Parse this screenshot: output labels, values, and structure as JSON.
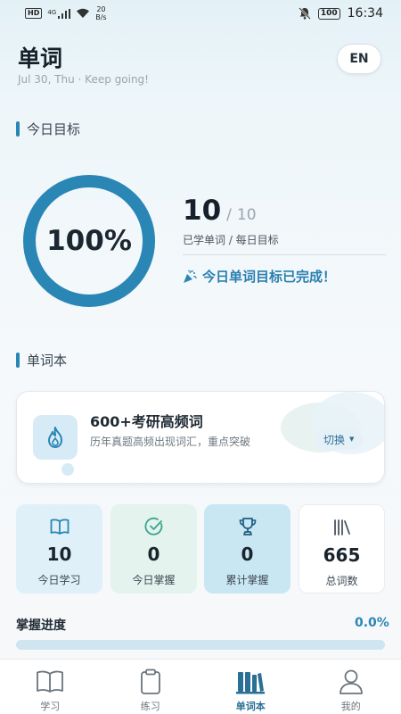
{
  "status_bar": {
    "network_badge": "HD",
    "signal_label": "4G",
    "net_speed_value": "20",
    "net_speed_unit": "B/s",
    "battery": "100",
    "time": "16:34"
  },
  "header": {
    "title": "单词",
    "subtitle": "Jul 30, Thu · Keep going!",
    "lang_button": "EN"
  },
  "today_goal": {
    "section_title": "今日目标",
    "progress_percent_text": "100%",
    "progress_fraction": 1.0,
    "learned": "10",
    "separator": "/",
    "target": "10",
    "label": "已学单词 / 每日目标",
    "completed_message": "今日单词目标已完成！"
  },
  "wordbook": {
    "section_title": "单词本",
    "book_title": "600+考研高频词",
    "book_desc": "历年真题高频出现词汇，重点突破",
    "switch_label": "切换"
  },
  "stats": [
    {
      "value": "10",
      "label": "今日学习",
      "icon": "book-open-icon"
    },
    {
      "value": "0",
      "label": "今日掌握",
      "icon": "check-circle-icon"
    },
    {
      "value": "0",
      "label": "累计掌握",
      "icon": "trophy-icon"
    },
    {
      "value": "665",
      "label": "总词数",
      "icon": "library-icon"
    }
  ],
  "mastery": {
    "label": "掌握进度",
    "value_text": "0.0%",
    "fraction": 0.0
  },
  "bottom_nav": [
    {
      "label": "学习",
      "icon": "book-icon"
    },
    {
      "label": "练习",
      "icon": "clipboard-icon"
    },
    {
      "label": "单词本",
      "icon": "books-icon",
      "active": true
    },
    {
      "label": "我的",
      "icon": "user-icon"
    }
  ],
  "colors": {
    "accent": "#2a86b5",
    "ring_track": "#dbe8ef"
  }
}
